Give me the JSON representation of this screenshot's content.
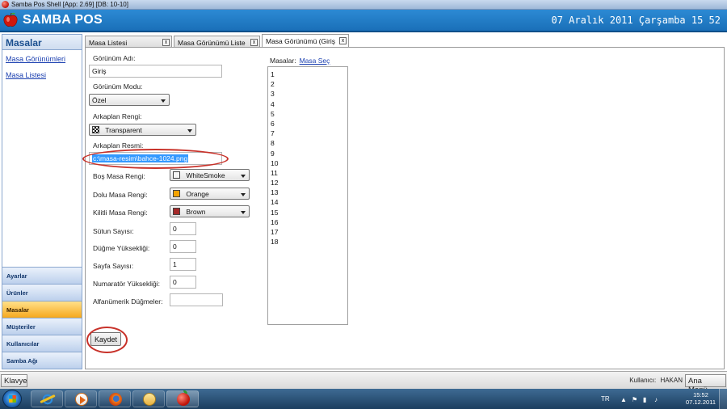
{
  "window": {
    "title": "Samba Pos Shell [App: 2.69] [DB: 10-10]"
  },
  "header": {
    "logo_text": "SAMBA POS",
    "datetime": "07 Aralık 2011 Çarşamba 15 52"
  },
  "sidebar": {
    "title": "Masalar",
    "links": [
      "Masa Görünümleri",
      "Masa Listesi"
    ],
    "nav": [
      "Ayarlar",
      "Ürünler",
      "Masalar",
      "Müşteriler",
      "Kullanıcılar",
      "Samba Ağı"
    ],
    "active_nav": "Masalar"
  },
  "tabs": [
    {
      "label": "Masa Listesi",
      "close": "x",
      "active": false
    },
    {
      "label": "Masa Görünümü Liste",
      "close": "x",
      "active": false
    },
    {
      "label": "Masa Görünümü (Giriş",
      "close": "x",
      "active": true
    }
  ],
  "form": {
    "view_name_label": "Görünüm Adı:",
    "view_name_value": "Giriş",
    "view_mode_label": "Görünüm Modu:",
    "view_mode_value": "Özel",
    "bg_color_label": "Arkaplan Rengi:",
    "bg_color_value": "Transparent",
    "bg_image_label": "Arkaplan Resmi:",
    "bg_image_value": "c:\\masa-resim\\bahce-1024.png",
    "empty_color_label": "Boş Masa Rengi:",
    "empty_color_value": "WhiteSmoke",
    "empty_color_hex": "#f5f5f5",
    "full_color_label": "Dolu Masa Rengi:",
    "full_color_value": "Orange",
    "full_color_hex": "#f5a300",
    "locked_color_label": "Kilitli Masa Rengi:",
    "locked_color_value": "Brown",
    "locked_color_hex": "#a52a2a",
    "column_count_label": "Sütun Sayısı:",
    "column_count_value": "0",
    "button_height_label": "Düğme Yüksekliği:",
    "button_height_value": "0",
    "page_count_label": "Sayfa Sayısı:",
    "page_count_value": "1",
    "numerator_height_label": "Numaratör Yüksekliği:",
    "numerator_height_value": "0",
    "alnum_buttons_label": "Alfanümerik Düğmeler:",
    "alnum_buttons_value": "",
    "save_label": "Kaydet"
  },
  "tables": {
    "label": "Masalar:",
    "select_link": "Masa Seç",
    "items": [
      "1",
      "2",
      "3",
      "4",
      "5",
      "6",
      "7",
      "8",
      "9",
      "10",
      "11",
      "12",
      "13",
      "14",
      "15",
      "16",
      "17",
      "18"
    ]
  },
  "statusbar": {
    "keyboard_label": "Klavye",
    "user_label": "Kullanıcı:",
    "user_name": "HAKAN",
    "main_menu_label": "Ana Menü"
  },
  "taskbar": {
    "apps": [
      "internet-explorer-icon",
      "media-player-icon",
      "firefox-icon",
      "folder-icon",
      "samba-pos-icon"
    ],
    "tray": {
      "lang": "TR",
      "time": "15:52",
      "date": "07.12.2011"
    }
  },
  "colors": {
    "header_blue": "#1f7cc7",
    "active_nav": "#f6a81e",
    "annotation_red": "#c8322a"
  }
}
